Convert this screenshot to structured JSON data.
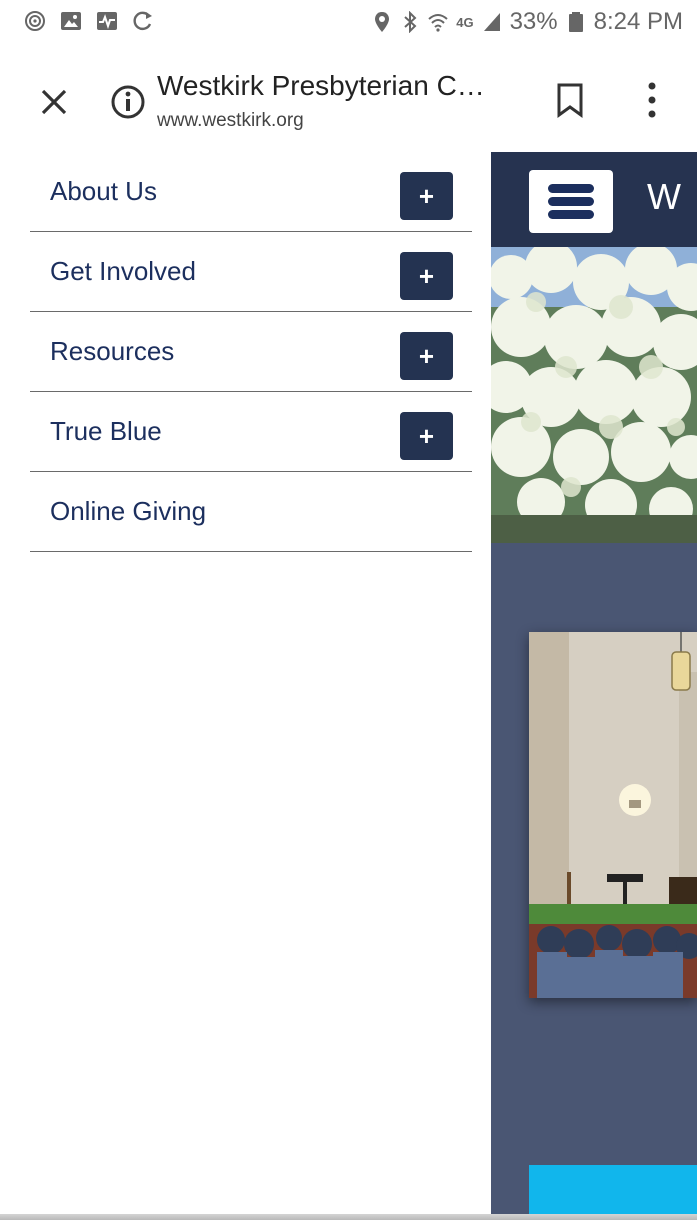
{
  "status_bar": {
    "battery_text": "33%",
    "time": "8:24 PM",
    "network_label": "4G"
  },
  "browser": {
    "page_title": "Westkirk Presbyterian C…",
    "page_url": "www.westkirk.org"
  },
  "nav": {
    "items": [
      {
        "label": "About Us",
        "expand": "+"
      },
      {
        "label": "Get Involved",
        "expand": "+"
      },
      {
        "label": "Resources",
        "expand": "+"
      },
      {
        "label": "True Blue",
        "expand": "+"
      },
      {
        "label": "Online Giving"
      }
    ]
  },
  "site": {
    "title_partial": "W"
  },
  "colors": {
    "nav_text": "#1c2f5e",
    "plus_button": "#243351",
    "site_header": "#263350",
    "site_background": "#4a5673",
    "cta": "#11b6ec"
  }
}
